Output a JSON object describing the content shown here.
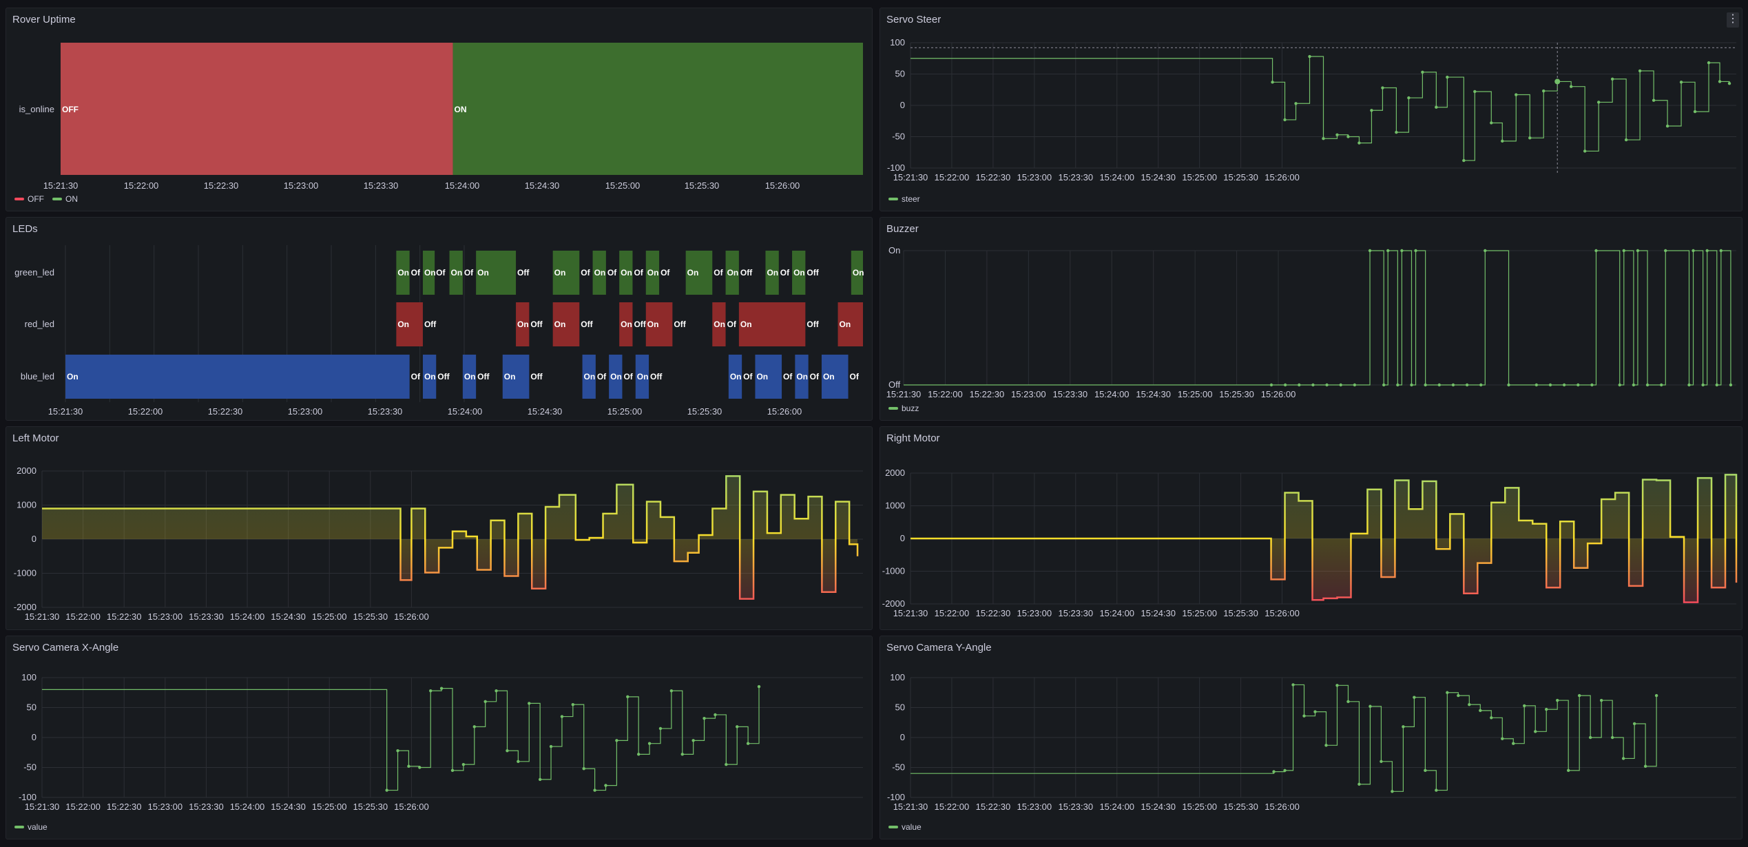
{
  "x_ticks": [
    "15:21:30",
    "15:22:00",
    "15:22:30",
    "15:23:00",
    "15:23:30",
    "15:24:00",
    "15:24:30",
    "15:25:00",
    "15:25:30",
    "15:26:00"
  ],
  "colors": {
    "green": "#73bf69",
    "state_green": "#37872d",
    "state_red": "#c4162a",
    "state_blue": "#1f60c4",
    "yellow": "#fade2a",
    "red": "#f2495c"
  },
  "rover": {
    "title": "Rover Uptime",
    "row_label": "is_online",
    "legend": [
      {
        "label": "OFF",
        "color": "#f2495c"
      },
      {
        "label": "ON",
        "color": "#73bf69"
      }
    ],
    "states": [
      {
        "start": 0,
        "end": 264,
        "value": "OFF"
      },
      {
        "start": 264,
        "end": 540,
        "value": "ON"
      }
    ]
  },
  "steer": {
    "title": "Servo Steer",
    "legend": "steer",
    "y_ticks": [
      "100",
      "50",
      "0",
      "-50",
      "-100"
    ],
    "data": [
      [
        0,
        75
      ],
      [
        258,
        75
      ],
      [
        263,
        37
      ],
      [
        272,
        -23
      ],
      [
        280,
        3
      ],
      [
        290,
        78
      ],
      [
        300,
        -53
      ],
      [
        310,
        -47
      ],
      [
        318,
        -50
      ],
      [
        326,
        -60
      ],
      [
        335,
        -8
      ],
      [
        343,
        28
      ],
      [
        353,
        -43
      ],
      [
        362,
        12
      ],
      [
        372,
        53
      ],
      [
        382,
        -3
      ],
      [
        390,
        45
      ],
      [
        402,
        -88
      ],
      [
        410,
        22
      ],
      [
        422,
        -28
      ],
      [
        430,
        -57
      ],
      [
        440,
        17
      ],
      [
        450,
        -52
      ],
      [
        460,
        23
      ],
      [
        470,
        38
      ],
      [
        480,
        30
      ],
      [
        490,
        -73
      ],
      [
        500,
        5
      ],
      [
        510,
        42
      ],
      [
        520,
        -55
      ],
      [
        530,
        55
      ],
      [
        540,
        8
      ],
      [
        550,
        -33
      ],
      [
        560,
        37
      ],
      [
        570,
        -10
      ],
      [
        580,
        68
      ],
      [
        588,
        38
      ],
      [
        595,
        35
      ]
    ]
  },
  "leds": {
    "title": "LEDs",
    "rows": [
      {
        "name": "green_led",
        "segments": [
          {
            "s": 224,
            "e": 233,
            "v": "On"
          },
          {
            "s": 233,
            "e": 242,
            "v": "Of"
          },
          {
            "s": 242,
            "e": 250,
            "v": "On"
          },
          {
            "s": 250,
            "e": 260,
            "v": "Of"
          },
          {
            "s": 260,
            "e": 269,
            "v": "On"
          },
          {
            "s": 269,
            "e": 278,
            "v": "Of"
          },
          {
            "s": 278,
            "e": 305,
            "v": "On"
          },
          {
            "s": 305,
            "e": 330,
            "v": "Off"
          },
          {
            "s": 330,
            "e": 348,
            "v": "On"
          },
          {
            "s": 348,
            "e": 357,
            "v": "Of"
          },
          {
            "s": 357,
            "e": 366,
            "v": "On"
          },
          {
            "s": 366,
            "e": 375,
            "v": "Of"
          },
          {
            "s": 375,
            "e": 384,
            "v": "On"
          },
          {
            "s": 384,
            "e": 393,
            "v": "Of"
          },
          {
            "s": 393,
            "e": 402,
            "v": "On"
          },
          {
            "s": 402,
            "e": 420,
            "v": "Of"
          },
          {
            "s": 420,
            "e": 438,
            "v": "On"
          },
          {
            "s": 438,
            "e": 447,
            "v": "Of"
          },
          {
            "s": 447,
            "e": 456,
            "v": "On"
          },
          {
            "s": 456,
            "e": 474,
            "v": "Off"
          },
          {
            "s": 474,
            "e": 483,
            "v": "On"
          },
          {
            "s": 483,
            "e": 492,
            "v": "Of"
          },
          {
            "s": 492,
            "e": 501,
            "v": "On"
          },
          {
            "s": 501,
            "e": 532,
            "v": "Off"
          },
          {
            "s": 532,
            "e": 540,
            "v": "On"
          }
        ]
      },
      {
        "name": "red_led",
        "segments": [
          {
            "s": 224,
            "e": 242,
            "v": "On"
          },
          {
            "s": 242,
            "e": 305,
            "v": "Off"
          },
          {
            "s": 305,
            "e": 314,
            "v": "On"
          },
          {
            "s": 314,
            "e": 330,
            "v": "Off"
          },
          {
            "s": 330,
            "e": 348,
            "v": "On"
          },
          {
            "s": 348,
            "e": 375,
            "v": "Off"
          },
          {
            "s": 375,
            "e": 384,
            "v": "On"
          },
          {
            "s": 384,
            "e": 393,
            "v": "Off"
          },
          {
            "s": 393,
            "e": 411,
            "v": "On"
          },
          {
            "s": 411,
            "e": 438,
            "v": "Off"
          },
          {
            "s": 438,
            "e": 447,
            "v": "On"
          },
          {
            "s": 447,
            "e": 456,
            "v": "Of"
          },
          {
            "s": 456,
            "e": 501,
            "v": "On"
          },
          {
            "s": 501,
            "e": 523,
            "v": "Off"
          },
          {
            "s": 523,
            "e": 540,
            "v": "On"
          }
        ]
      },
      {
        "name": "blue_led",
        "segments": [
          {
            "s": 0,
            "e": 233,
            "v": "On"
          },
          {
            "s": 233,
            "e": 242,
            "v": "Of"
          },
          {
            "s": 242,
            "e": 251,
            "v": "On"
          },
          {
            "s": 251,
            "e": 269,
            "v": "Off"
          },
          {
            "s": 269,
            "e": 278,
            "v": "On"
          },
          {
            "s": 278,
            "e": 296,
            "v": "Off"
          },
          {
            "s": 296,
            "e": 314,
            "v": "On"
          },
          {
            "s": 314,
            "e": 350,
            "v": "Off"
          },
          {
            "s": 350,
            "e": 359,
            "v": "On"
          },
          {
            "s": 359,
            "e": 368,
            "v": "Of"
          },
          {
            "s": 368,
            "e": 377,
            "v": "On"
          },
          {
            "s": 377,
            "e": 386,
            "v": "Of"
          },
          {
            "s": 386,
            "e": 395,
            "v": "On"
          },
          {
            "s": 395,
            "e": 449,
            "v": "Off"
          },
          {
            "s": 449,
            "e": 458,
            "v": "On"
          },
          {
            "s": 458,
            "e": 467,
            "v": "Of"
          },
          {
            "s": 467,
            "e": 485,
            "v": "On"
          },
          {
            "s": 485,
            "e": 494,
            "v": "Of"
          },
          {
            "s": 494,
            "e": 503,
            "v": "On"
          },
          {
            "s": 503,
            "e": 512,
            "v": "Of"
          },
          {
            "s": 512,
            "e": 530,
            "v": "On"
          },
          {
            "s": 530,
            "e": 540,
            "v": "Of"
          }
        ]
      }
    ]
  },
  "buzzer": {
    "title": "Buzzer",
    "legend": "buzz",
    "y_labels": [
      "On",
      "Off"
    ],
    "data": [
      [
        0,
        0
      ],
      [
        265,
        0
      ],
      [
        275,
        0
      ],
      [
        285,
        0
      ],
      [
        295,
        0
      ],
      [
        305,
        0
      ],
      [
        315,
        0
      ],
      [
        325,
        0
      ],
      [
        336,
        1
      ],
      [
        346,
        0
      ],
      [
        349,
        1
      ],
      [
        356,
        0
      ],
      [
        359,
        1
      ],
      [
        366,
        0
      ],
      [
        369,
        1
      ],
      [
        376,
        0
      ],
      [
        386,
        0
      ],
      [
        396,
        0
      ],
      [
        406,
        0
      ],
      [
        416,
        0
      ],
      [
        419,
        1
      ],
      [
        436,
        0
      ],
      [
        456,
        0
      ],
      [
        466,
        0
      ],
      [
        476,
        0
      ],
      [
        486,
        0
      ],
      [
        496,
        0
      ],
      [
        499,
        1
      ],
      [
        516,
        0
      ],
      [
        519,
        1
      ],
      [
        526,
        0
      ],
      [
        529,
        1
      ],
      [
        536,
        0
      ],
      [
        546,
        0
      ],
      [
        549,
        1
      ],
      [
        566,
        0
      ],
      [
        569,
        1
      ],
      [
        576,
        0
      ],
      [
        579,
        1
      ],
      [
        586,
        0
      ],
      [
        589,
        1
      ],
      [
        596,
        0
      ]
    ]
  },
  "left": {
    "title": "Left Motor",
    "y_ticks": [
      "2000",
      "1000",
      "0",
      "-1000",
      "-2000"
    ],
    "data": [
      [
        0,
        900
      ],
      [
        258,
        900
      ],
      [
        262,
        -1200
      ],
      [
        270,
        900
      ],
      [
        280,
        -980
      ],
      [
        290,
        -250
      ],
      [
        300,
        230
      ],
      [
        310,
        80
      ],
      [
        318,
        -900
      ],
      [
        328,
        550
      ],
      [
        338,
        -1080
      ],
      [
        348,
        750
      ],
      [
        358,
        -1450
      ],
      [
        368,
        950
      ],
      [
        378,
        1300
      ],
      [
        390,
        -20
      ],
      [
        400,
        40
      ],
      [
        410,
        750
      ],
      [
        420,
        1600
      ],
      [
        432,
        -100
      ],
      [
        442,
        1100
      ],
      [
        452,
        650
      ],
      [
        462,
        -650
      ],
      [
        472,
        -400
      ],
      [
        480,
        120
      ],
      [
        490,
        900
      ],
      [
        500,
        1850
      ],
      [
        510,
        -1750
      ],
      [
        520,
        1400
      ],
      [
        530,
        180
      ],
      [
        540,
        1300
      ],
      [
        550,
        600
      ],
      [
        560,
        1250
      ],
      [
        570,
        -1550
      ],
      [
        580,
        1100
      ],
      [
        590,
        -150
      ],
      [
        596,
        -500
      ]
    ]
  },
  "right": {
    "title": "Right Motor",
    "y_ticks": [
      "2000",
      "1000",
      "0",
      "-1000",
      "-2000"
    ],
    "data": [
      [
        0,
        0
      ],
      [
        258,
        0
      ],
      [
        262,
        -1250
      ],
      [
        272,
        1400
      ],
      [
        282,
        1150
      ],
      [
        292,
        -1880
      ],
      [
        300,
        -1830
      ],
      [
        310,
        -1800
      ],
      [
        320,
        150
      ],
      [
        332,
        1500
      ],
      [
        342,
        -1180
      ],
      [
        352,
        1780
      ],
      [
        362,
        900
      ],
      [
        372,
        1750
      ],
      [
        382,
        -320
      ],
      [
        392,
        750
      ],
      [
        402,
        -1680
      ],
      [
        412,
        -750
      ],
      [
        422,
        1100
      ],
      [
        432,
        1550
      ],
      [
        442,
        550
      ],
      [
        452,
        450
      ],
      [
        462,
        -1500
      ],
      [
        472,
        520
      ],
      [
        482,
        -900
      ],
      [
        492,
        -150
      ],
      [
        502,
        1200
      ],
      [
        512,
        1400
      ],
      [
        522,
        -1450
      ],
      [
        532,
        1800
      ],
      [
        542,
        1780
      ],
      [
        552,
        50
      ],
      [
        562,
        -1950
      ],
      [
        572,
        1850
      ],
      [
        582,
        -1500
      ],
      [
        592,
        1950
      ],
      [
        600,
        -1350
      ]
    ]
  },
  "camx": {
    "title": "Servo Camera X-Angle",
    "legend": "value",
    "y_ticks": [
      "100",
      "50",
      "0",
      "-50",
      "-100"
    ],
    "data": [
      [
        0,
        80
      ],
      [
        248,
        80
      ],
      [
        252,
        -88
      ],
      [
        260,
        -22
      ],
      [
        268,
        -48
      ],
      [
        276,
        -50
      ],
      [
        284,
        78
      ],
      [
        292,
        82
      ],
      [
        300,
        -55
      ],
      [
        308,
        -45
      ],
      [
        316,
        18
      ],
      [
        324,
        60
      ],
      [
        332,
        78
      ],
      [
        340,
        -22
      ],
      [
        348,
        -40
      ],
      [
        356,
        57
      ],
      [
        364,
        -70
      ],
      [
        372,
        -15
      ],
      [
        380,
        35
      ],
      [
        388,
        55
      ],
      [
        396,
        -52
      ],
      [
        404,
        -88
      ],
      [
        412,
        -80
      ],
      [
        420,
        -5
      ],
      [
        428,
        68
      ],
      [
        436,
        -28
      ],
      [
        444,
        -10
      ],
      [
        452,
        15
      ],
      [
        460,
        78
      ],
      [
        468,
        -28
      ],
      [
        476,
        -5
      ],
      [
        484,
        32
      ],
      [
        492,
        38
      ],
      [
        500,
        -45
      ],
      [
        508,
        18
      ],
      [
        516,
        -10
      ],
      [
        524,
        85
      ]
    ]
  },
  "camy": {
    "title": "Servo Camera Y-Angle",
    "legend": "value",
    "y_ticks": [
      "100",
      "50",
      "0",
      "-50",
      "-100"
    ],
    "data": [
      [
        0,
        -60
      ],
      [
        258,
        -60
      ],
      [
        264,
        -57
      ],
      [
        272,
        -55
      ],
      [
        278,
        88
      ],
      [
        286,
        36
      ],
      [
        294,
        43
      ],
      [
        302,
        -13
      ],
      [
        310,
        87
      ],
      [
        318,
        60
      ],
      [
        326,
        -78
      ],
      [
        334,
        52
      ],
      [
        342,
        -40
      ],
      [
        350,
        -90
      ],
      [
        358,
        18
      ],
      [
        366,
        67
      ],
      [
        374,
        -55
      ],
      [
        382,
        -88
      ],
      [
        390,
        75
      ],
      [
        398,
        70
      ],
      [
        406,
        55
      ],
      [
        414,
        45
      ],
      [
        422,
        33
      ],
      [
        430,
        -2
      ],
      [
        438,
        -10
      ],
      [
        446,
        53
      ],
      [
        454,
        10
      ],
      [
        462,
        47
      ],
      [
        470,
        62
      ],
      [
        478,
        -55
      ],
      [
        486,
        70
      ],
      [
        494,
        0
      ],
      [
        502,
        62
      ],
      [
        510,
        0
      ],
      [
        518,
        -35
      ],
      [
        526,
        23
      ],
      [
        534,
        -48
      ],
      [
        542,
        70
      ]
    ]
  }
}
